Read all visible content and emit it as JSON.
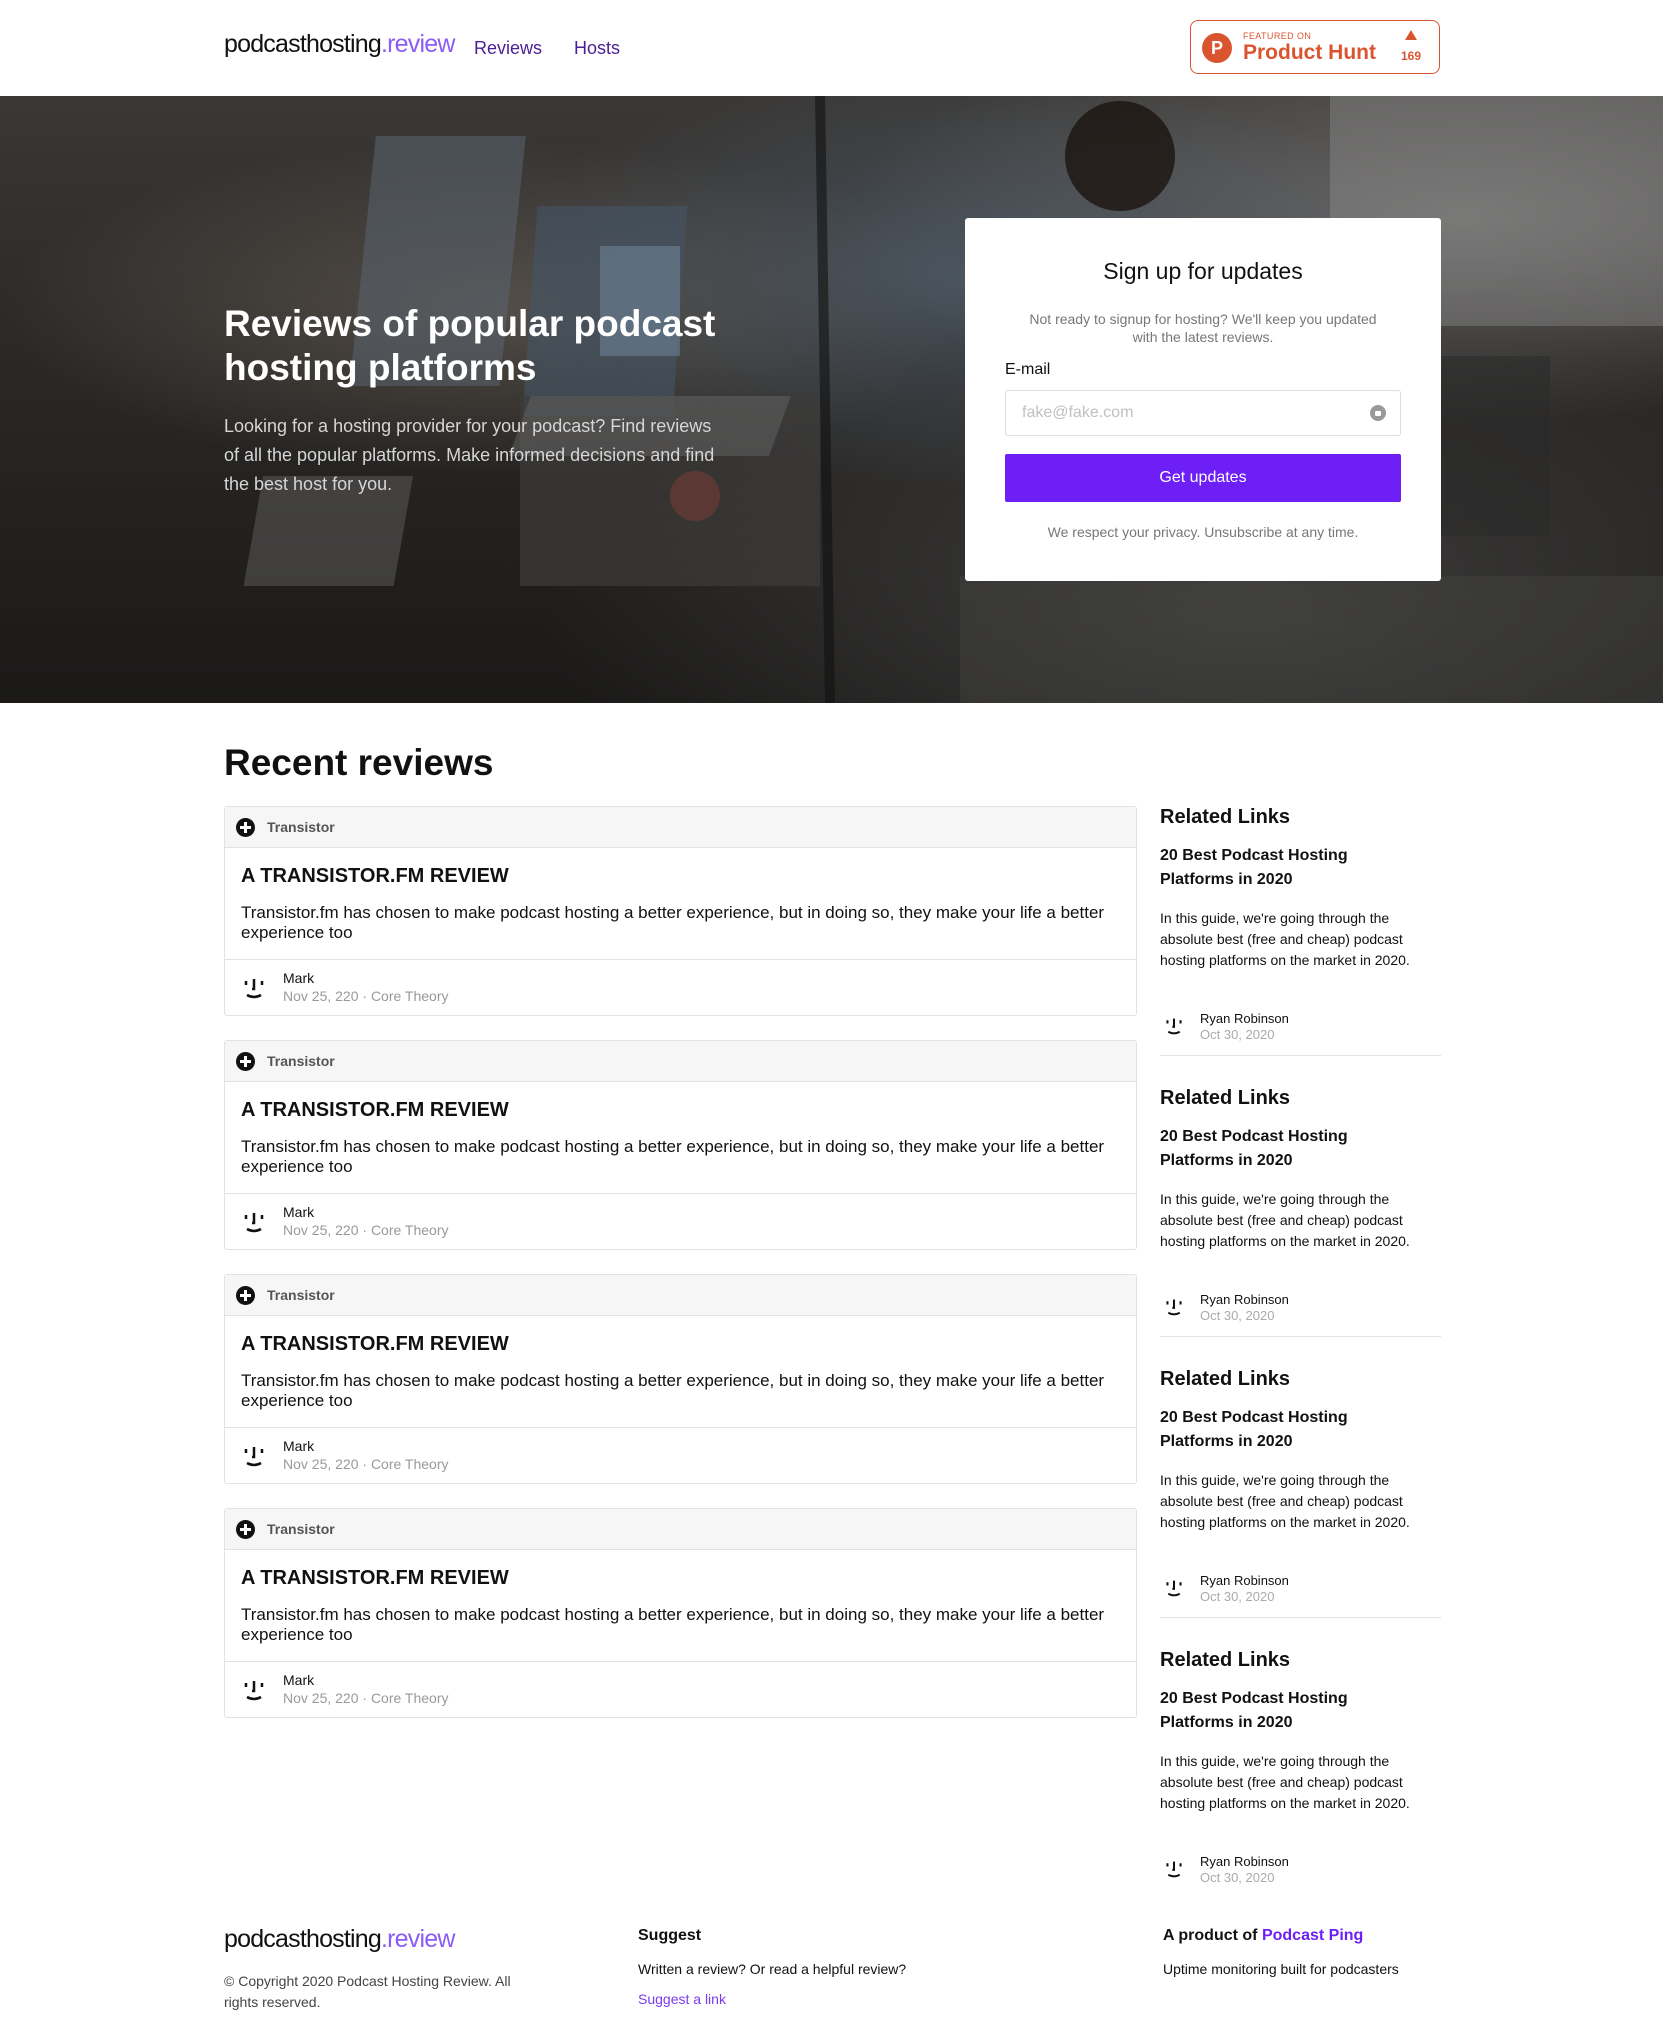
{
  "header": {
    "logo_main": "podcasthosting",
    "logo_accent": ".review",
    "nav": [
      {
        "label": "Reviews"
      },
      {
        "label": "Hosts"
      }
    ],
    "product_hunt": {
      "letter": "P",
      "featured": "FEATURED ON",
      "title": "Product Hunt",
      "count": "169"
    }
  },
  "hero": {
    "title": "Reviews of popular podcast hosting platforms",
    "subtitle": "Looking for a hosting provider for your podcast? Find reviews of all the popular platforms. Make informed decisions and find the best host for you."
  },
  "signup": {
    "title": "Sign up for updates",
    "description": "Not ready to signup for hosting? We'll keep you updated with the latest reviews.",
    "email_label": "E-mail",
    "email_placeholder": "fake@fake.com",
    "button": "Get updates",
    "privacy": "We respect your privacy. Unsubscribe at any time."
  },
  "reviews": {
    "title": "Recent reviews",
    "items": [
      {
        "host": "Transistor",
        "title": "A TRANSISTOR.FM REVIEW",
        "body": "Transistor.fm has chosen to make podcast hosting a better experience, but in doing so, they make your life a better experience too",
        "author": "Mark",
        "meta": "Nov 25, 220 · Core Theory"
      },
      {
        "host": "Transistor",
        "title": "A TRANSISTOR.FM REVIEW",
        "body": "Transistor.fm has chosen to make podcast hosting a better experience, but in doing so, they make your life a better experience too",
        "author": "Mark",
        "meta": "Nov 25, 220 · Core Theory"
      },
      {
        "host": "Transistor",
        "title": "A TRANSISTOR.FM REVIEW",
        "body": "Transistor.fm has chosen to make podcast hosting a better experience, but in doing so, they make your life a better experience too",
        "author": "Mark",
        "meta": "Nov 25, 220 · Core Theory"
      },
      {
        "host": "Transistor",
        "title": "A TRANSISTOR.FM REVIEW",
        "body": "Transistor.fm has chosen to make podcast hosting a better experience, but in doing so, they make your life a better experience too",
        "author": "Mark",
        "meta": "Nov 25, 220 · Core Theory"
      }
    ]
  },
  "sidebar": {
    "items": [
      {
        "heading": "Related Links",
        "link_title": "20 Best Podcast Hosting Platforms in 2020",
        "description": "In this guide, we're going through the absolute best (free and cheap) podcast hosting platforms on the market in 2020.",
        "author": "Ryan Robinson",
        "date": "Oct 30, 2020"
      },
      {
        "heading": "Related Links",
        "link_title": "20 Best Podcast Hosting Platforms in 2020",
        "description": "In this guide, we're going through the absolute best (free and cheap) podcast hosting platforms on the market in 2020.",
        "author": "Ryan Robinson",
        "date": "Oct 30, 2020"
      },
      {
        "heading": "Related Links",
        "link_title": "20 Best Podcast Hosting Platforms in 2020",
        "description": "In this guide, we're going through the absolute best (free and cheap) podcast hosting platforms on the market in 2020.",
        "author": "Ryan Robinson",
        "date": "Oct 30, 2020"
      },
      {
        "heading": "Related Links",
        "link_title": "20 Best Podcast Hosting Platforms in 2020",
        "description": "In this guide, we're going through the absolute best (free and cheap) podcast hosting platforms on the market in 2020.",
        "author": "Ryan Robinson",
        "date": "Oct 30, 2020"
      }
    ]
  },
  "footer": {
    "logo_main": "podcasthosting",
    "logo_accent": ".review",
    "copyright": "© Copyright 2020 Podcast Hosting Review. All rights reserved.",
    "suggest_heading": "Suggest",
    "suggest_text": "Written a review? Or read a helpful review?",
    "suggest_link": "Suggest a link",
    "product_prefix": "A product of ",
    "product_link": "Podcast Ping",
    "product_text": "Uptime monitoring built for podcasters"
  },
  "colors": {
    "brand_purple": "#6d1ff5",
    "logo_accent": "#8b5cf6",
    "product_hunt": "#da552f"
  }
}
